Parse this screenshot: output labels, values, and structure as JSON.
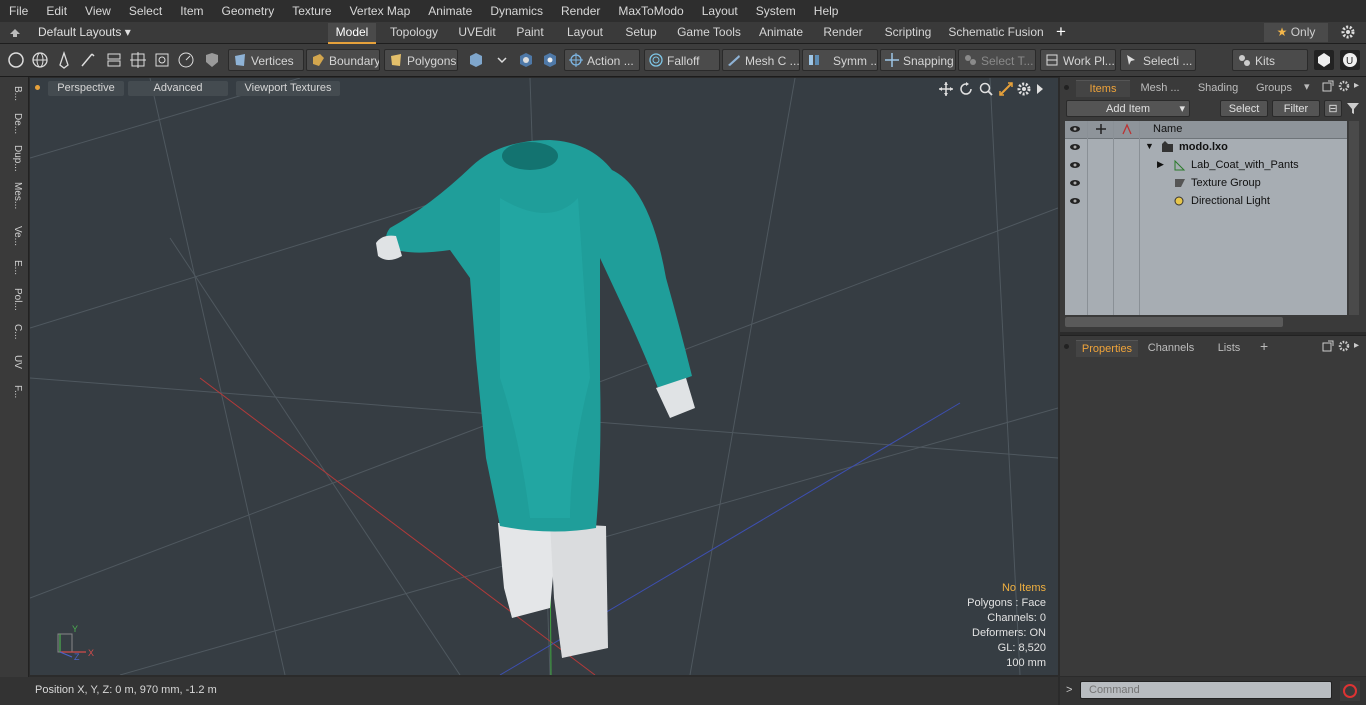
{
  "menu": [
    "File",
    "Edit",
    "View",
    "Select",
    "Item",
    "Geometry",
    "Texture",
    "Vertex Map",
    "Animate",
    "Dynamics",
    "Render",
    "MaxToModo",
    "Layout",
    "System",
    "Help"
  ],
  "layout_selector": "Default Layouts",
  "layout_tabs": [
    "Model",
    "Topology",
    "UVEdit",
    "Paint",
    "Layout",
    "Setup",
    "Game Tools",
    "Animate",
    "Render",
    "Scripting",
    "Schematic Fusion"
  ],
  "active_layout_tab": "Model",
  "only_label": "Only",
  "toolbar": {
    "vertices": "Vertices",
    "boundary": "Boundary",
    "polygons": "Polygons",
    "action": "Action",
    "falloff": "Falloff",
    "mesh_c": "Mesh C ...",
    "symm": "Symm ...",
    "snapping": "Snapping",
    "select_t": "Select T...",
    "work_pl": "Work Pl...",
    "selecti": "Selecti ...",
    "kits": "Kits"
  },
  "left_tabs": [
    "B...",
    "De...",
    "Dup...",
    "Mes...",
    "Ve...",
    "E...",
    "Pol...",
    "C...",
    "UV",
    "F..."
  ],
  "viewport": {
    "perspective": "Perspective",
    "advanced": "Advanced",
    "viewport_textures": "Viewport Textures",
    "stats": [
      "No Items",
      "Polygons : Face",
      "Channels: 0",
      "Deformers: ON",
      "GL: 8,520",
      "100 mm"
    ],
    "axes": {
      "x": "X",
      "y": "Y",
      "z": "Z"
    }
  },
  "status_bar": "Position X, Y, Z:   0 m, 970 mm, -1.2 m",
  "items_panel": {
    "tabs": [
      "Items",
      "Mesh ...",
      "Shading",
      "Groups"
    ],
    "active_tab": "Items",
    "add_item": "Add Item",
    "select": "Select",
    "filter": "Filter",
    "column_name": "Name",
    "rows": [
      {
        "label": "modo.lxo",
        "bold": true,
        "indent": 0
      },
      {
        "label": "Lab_Coat_with_Pants",
        "bold": false,
        "indent": 1
      },
      {
        "label": "Texture Group",
        "bold": false,
        "indent": 1
      },
      {
        "label": "Directional Light",
        "bold": false,
        "indent": 1
      }
    ]
  },
  "properties_panel": {
    "tabs": [
      "Properties",
      "Channels",
      "Lists"
    ],
    "active_tab": "Properties"
  },
  "command_placeholder": "Command",
  "colors": {
    "accent": "#e6a13b",
    "coat": "#1f9e9a",
    "pants": "#e4e6e8",
    "viewport_bg": "#363d43"
  }
}
